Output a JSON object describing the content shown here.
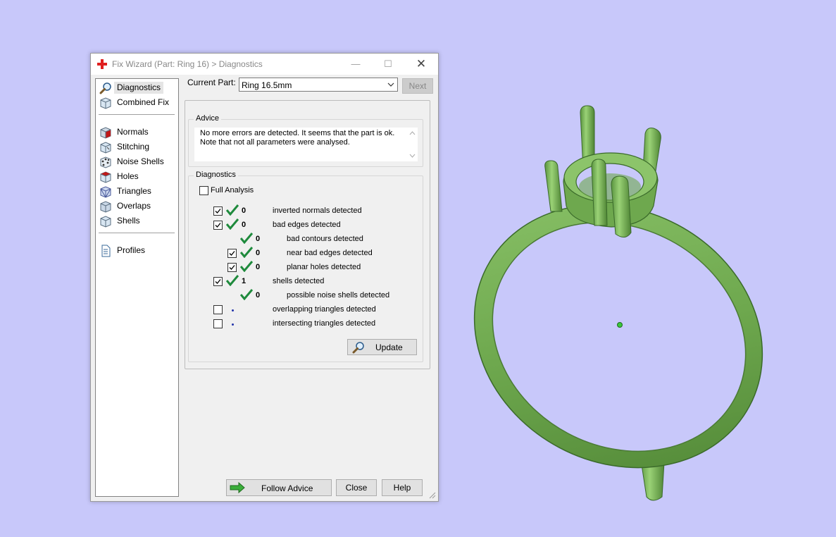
{
  "window": {
    "title": "Fix Wizard (Part: Ring 16) > Diagnostics",
    "minimize_glyph": "—",
    "maximize_glyph": "☐",
    "close_glyph": "✕"
  },
  "nav": {
    "items": [
      {
        "label": "Diagnostics",
        "icon": "magnifier-icon",
        "selected": true
      },
      {
        "label": "Combined Fix",
        "icon": "cube-icon"
      },
      {
        "label": "Normals",
        "icon": "normals-cube-icon"
      },
      {
        "label": "Stitching",
        "icon": "stitching-cube-icon"
      },
      {
        "label": "Noise Shells",
        "icon": "noise-shells-icon"
      },
      {
        "label": "Holes",
        "icon": "holes-cube-icon"
      },
      {
        "label": "Triangles",
        "icon": "triangles-cube-icon"
      },
      {
        "label": "Overlaps",
        "icon": "overlaps-cube-icon"
      },
      {
        "label": "Shells",
        "icon": "shells-cube-icon"
      },
      {
        "label": "Profiles",
        "icon": "document-icon"
      }
    ]
  },
  "current_part": {
    "label": "Current Part:",
    "value": "Ring 16.5mm",
    "next_label": "Next"
  },
  "advice": {
    "title": "Advice",
    "text": "No more errors are detected. It seems that the part is ok. Note that not all parameters were analysed."
  },
  "diagnostics": {
    "title": "Diagnostics",
    "full_analysis_label": "Full Analysis",
    "full_analysis_checked": false,
    "rows": [
      {
        "checked": true,
        "status": "ok",
        "count": "0",
        "label": "inverted normals detected",
        "level": 0
      },
      {
        "checked": true,
        "status": "ok",
        "count": "0",
        "label": "bad edges detected",
        "level": 0
      },
      {
        "checked": null,
        "status": "ok",
        "count": "0",
        "label": "bad contours detected",
        "level": 1
      },
      {
        "checked": true,
        "status": "ok",
        "count": "0",
        "label": "near bad edges detected",
        "level": 1
      },
      {
        "checked": true,
        "status": "ok",
        "count": "0",
        "label": "planar holes detected",
        "level": 1
      },
      {
        "checked": true,
        "status": "ok",
        "count": "1",
        "label": "shells detected",
        "level": 0
      },
      {
        "checked": null,
        "status": "ok",
        "count": "0",
        "label": "possible noise shells detected",
        "level": 1
      },
      {
        "checked": false,
        "status": "pending",
        "count": "",
        "label": "overlapping triangles detected",
        "level": 0
      },
      {
        "checked": false,
        "status": "pending",
        "count": "",
        "label": "intersecting triangles detected",
        "level": 0
      }
    ],
    "update_label": "Update"
  },
  "footer": {
    "follow_advice_label": "Follow Advice",
    "close_label": "Close",
    "help_label": "Help"
  },
  "colors": {
    "background": "#c8c8fa",
    "ring_green": "#6ea84e",
    "check_green": "#1e8a3c",
    "title_text": "#888888"
  }
}
